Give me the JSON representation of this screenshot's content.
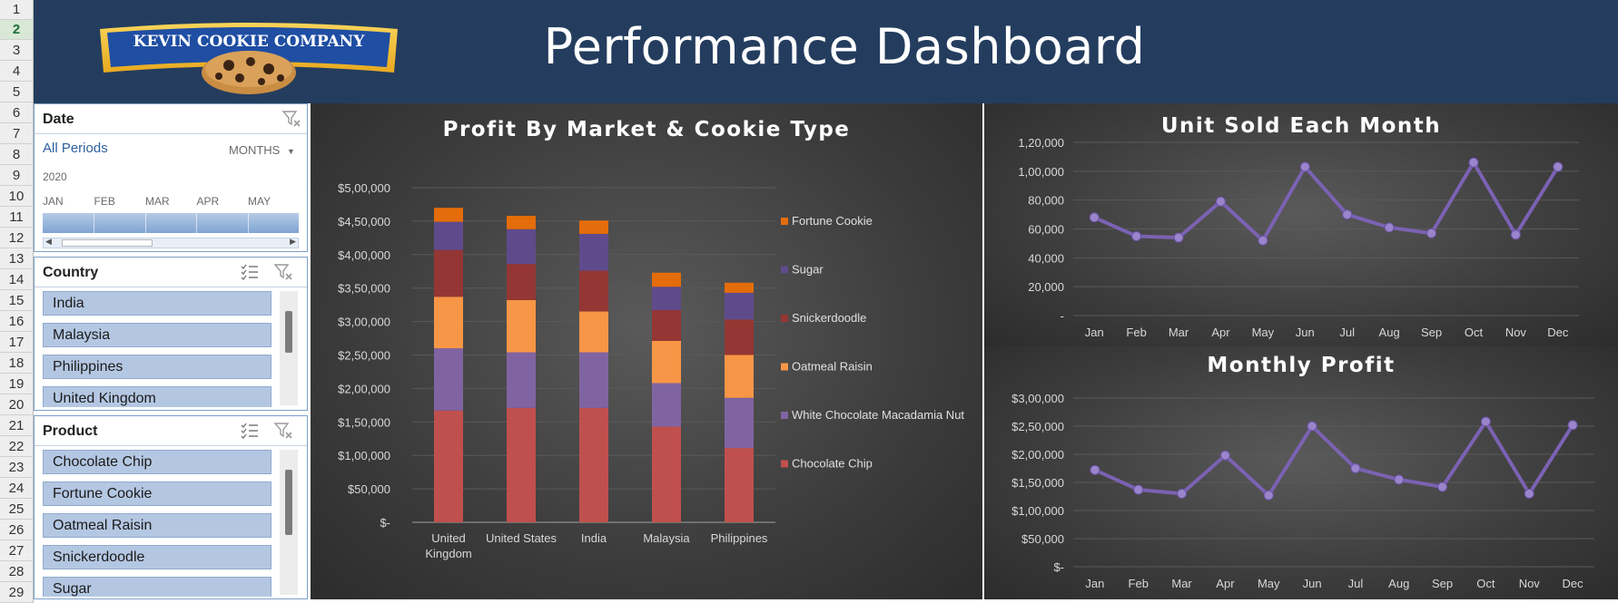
{
  "row_headers": [
    "1",
    "2",
    "3",
    "4",
    "5",
    "6",
    "7",
    "8",
    "9",
    "10",
    "11",
    "12",
    "13",
    "14",
    "15",
    "16",
    "17",
    "18",
    "19",
    "20",
    "21",
    "22",
    "23",
    "24",
    "25",
    "26",
    "27",
    "28",
    "29"
  ],
  "logo": {
    "text": "KEVIN COOKIE COMPANY"
  },
  "header": {
    "title": "Performance  Dashboard"
  },
  "date_slicer": {
    "title": "Date",
    "period_label": "All Periods",
    "level_label": "MONTHS",
    "year": "2020",
    "months": [
      "JAN",
      "FEB",
      "MAR",
      "APR",
      "MAY"
    ]
  },
  "country_slicer": {
    "title": "Country",
    "items": [
      "India",
      "Malaysia",
      "Philippines",
      "United Kingdom"
    ]
  },
  "product_slicer": {
    "title": "Product",
    "items": [
      "Chocolate Chip",
      "Fortune Cookie",
      "Oatmeal Raisin",
      "Snickerdoodle",
      "Sugar"
    ]
  },
  "colors": {
    "header_bg": "#243d5e",
    "slicer_item": "#b4c7e2",
    "line": "#7b62b3",
    "chocolate_chip": "#c0504d",
    "white_choc": "#8064a2",
    "oatmeal": "#f79646",
    "snickerdoodle": "#943634",
    "sugar": "#5f4b8b",
    "fortune": "#e46c0a"
  },
  "chart_data": [
    {
      "type": "bar",
      "stacked": true,
      "title": "Profit By Market & Cookie Type",
      "categories": [
        "United Kingdom",
        "United States",
        "India",
        "Malaysia",
        "Philippines"
      ],
      "category_lines": [
        [
          "United",
          "Kingdom"
        ],
        [
          "United States"
        ],
        [
          "India"
        ],
        [
          "Malaysia"
        ],
        [
          "Philippines"
        ]
      ],
      "yticks": [
        "$-",
        "$50,000",
        "$1,00,000",
        "$1,50,000",
        "$2,00,000",
        "$2,50,000",
        "$3,00,000",
        "$3,50,000",
        "$4,00,000",
        "$4,50,000",
        "$5,00,000"
      ],
      "ylim": [
        0,
        500000
      ],
      "legend": "right",
      "series": [
        {
          "name": "Chocolate Chip",
          "color": "#c0504d",
          "values": [
            167000,
            171000,
            171000,
            143000,
            111000
          ]
        },
        {
          "name": "White Chocolate Macadamia Nut",
          "color": "#8064a2",
          "values": [
            93000,
            83000,
            83000,
            65000,
            75000
          ]
        },
        {
          "name": "Oatmeal Raisin",
          "color": "#f79646",
          "values": [
            77000,
            78000,
            61000,
            63000,
            64000
          ]
        },
        {
          "name": "Snickerdoodle",
          "color": "#943634",
          "values": [
            70000,
            54000,
            61000,
            46000,
            53000
          ]
        },
        {
          "name": "Sugar",
          "color": "#5f4b8b",
          "values": [
            42000,
            52000,
            55000,
            35000,
            40000
          ]
        },
        {
          "name": "Fortune Cookie",
          "color": "#e46c0a",
          "values": [
            21000,
            20000,
            20000,
            21000,
            15000
          ]
        }
      ]
    },
    {
      "type": "line",
      "title": "Unit Sold Each Month",
      "categories": [
        "Jan",
        "Feb",
        "Mar",
        "Apr",
        "May",
        "Jun",
        "Jul",
        "Aug",
        "Sep",
        "Oct",
        "Nov",
        "Dec"
      ],
      "values": [
        68000,
        55000,
        54000,
        79000,
        52000,
        103000,
        70000,
        61000,
        57000,
        106000,
        56000,
        103000
      ],
      "yticks": [
        "-",
        "20,000",
        "40,000",
        "60,000",
        "80,000",
        "1,00,000",
        "1,20,000"
      ],
      "ylim": [
        0,
        120000
      ]
    },
    {
      "type": "line",
      "title": "Monthly Profit",
      "categories": [
        "Jan",
        "Feb",
        "Mar",
        "Apr",
        "May",
        "Jun",
        "Jul",
        "Aug",
        "Sep",
        "Oct",
        "Nov",
        "Dec"
      ],
      "values": [
        172000,
        137000,
        130000,
        198000,
        127000,
        250000,
        175000,
        155000,
        142000,
        258000,
        130000,
        252000
      ],
      "yticks": [
        "$-",
        "$50,000",
        "$1,00,000",
        "$1,50,000",
        "$2,00,000",
        "$2,50,000",
        "$3,00,000"
      ],
      "ylim": [
        0,
        300000
      ]
    }
  ]
}
